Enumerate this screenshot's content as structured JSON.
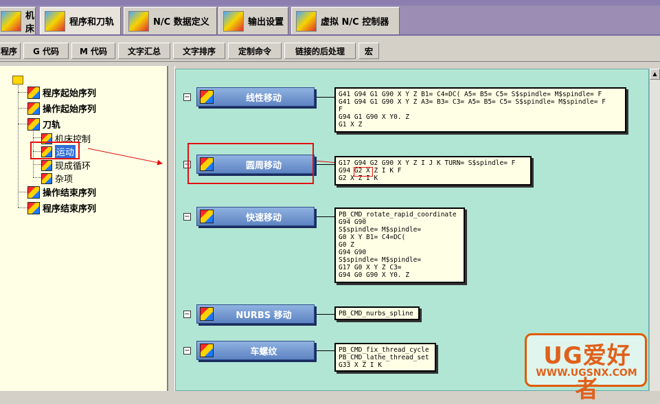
{
  "top_tabs": [
    {
      "label": "机床"
    },
    {
      "label": "程序和刀轨"
    },
    {
      "label": "N/C 数据定义"
    },
    {
      "label": "输出设置"
    },
    {
      "label": "虚拟 N/C 控制器"
    }
  ],
  "sub_tabs": [
    {
      "label": "程序"
    },
    {
      "label": "G 代码"
    },
    {
      "label": "M 代码"
    },
    {
      "label": "文字汇总"
    },
    {
      "label": "文字排序"
    },
    {
      "label": "定制命令"
    },
    {
      "label": "链接的后处理"
    },
    {
      "label": "宏"
    }
  ],
  "tree": {
    "nodes": [
      {
        "label": "程序起始序列"
      },
      {
        "label": "操作起始序列"
      },
      {
        "label": "刀轨"
      },
      {
        "label": "机床控制"
      },
      {
        "label": "运动"
      },
      {
        "label": "现成循环"
      },
      {
        "label": "杂项"
      },
      {
        "label": "操作结束序列"
      },
      {
        "label": "程序结束序列"
      }
    ]
  },
  "blocks": [
    {
      "label": "线性移动",
      "code": "G41 G94 G1 G90 X Y Z B1= C4=DC( A5= B5= C5= S$spindle= M$spindle= F\nG41 G94 G1 G90 X Y Z A3= B3= C3= A5= B5= C5= S$spindle= M$spindle= F\nF\nG94 G1 G90 X Y0. Z\nG1 X Z"
    },
    {
      "label": "圆周移动",
      "code": "G17 G94 G2 G90 X Y Z I J K TURN= S$spindle= F\nG94 G2 X Z I K F\nG2 X Z I K"
    },
    {
      "label": "快速移动",
      "code": "PB_CMD_rotate_rapid_coordinate\nG94 G90\nS$spindle= M$spindle=\nG0 X Y B1= C4=DC(\nG0 Z\nG94 G90\nS$spindle= M$spindle=\nG17 G0 X Y Z C3=\nG94 G0 G90 X Y0. Z"
    },
    {
      "label": "NURBS 移动",
      "code": "PB_CMD_nurbs_spline"
    },
    {
      "label": "车螺纹",
      "code": "PB_CMD_fix_thread_cycle\nPB_CMD_lathe_thread_set\nG33 X Z I K"
    }
  ],
  "watermark": {
    "main": "UG爱好者",
    "url": "WWW.UGSNX.COM"
  },
  "colors": {
    "workspace": "#b2e6d4",
    "tree_bg": "#ffffe6",
    "button": "#5d83c2",
    "highlight": "#e01010",
    "watermark": "#e0601a"
  }
}
